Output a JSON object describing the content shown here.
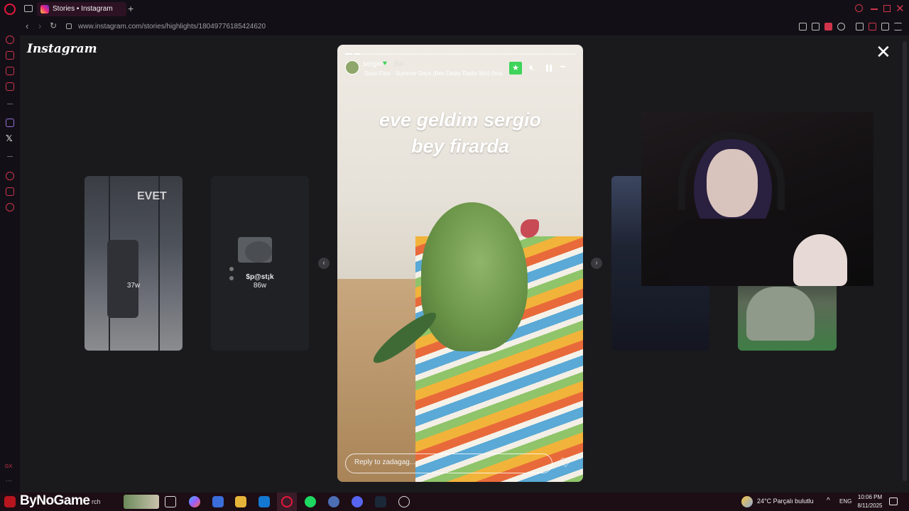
{
  "browser": {
    "tab_title": "Stories • Instagram",
    "new_tab_glyph": "+",
    "url": "www.instagram.com/stories/highlights/18049776185424620",
    "close_glyph": "✕"
  },
  "instagram": {
    "logo": "Instagram",
    "close_glyph": "✕"
  },
  "side_cards": [
    {
      "overlay_text": "EVET",
      "time": "37w"
    },
    {
      "center_text": "$p@st¡k",
      "time": "86w"
    }
  ],
  "story": {
    "username": "sergio",
    "age": "6w",
    "song": "Sean Finn · Summer Days (Ben Delay Radio Mix) (feat.",
    "caption_line1": "eve geldim sergio",
    "caption_line2": "bey firarda",
    "reply_placeholder": "Reply to zadagag...",
    "more_glyph": "•••",
    "progress_segments": 3,
    "progress_done": 2
  },
  "nav": {
    "prev_glyph": "‹",
    "next_glyph": "›"
  },
  "taskbar": {
    "watermark": "ByNoGame",
    "search_fragment": "rch",
    "weather": "24°C  Parçalı bulutlu",
    "lang": "ENG",
    "time": "10:06 PM",
    "date": "8/11/2025"
  },
  "colors": {
    "accent": "#e8173c",
    "close_friends": "#3ed45a",
    "page_bg": "#1a1a1d"
  }
}
